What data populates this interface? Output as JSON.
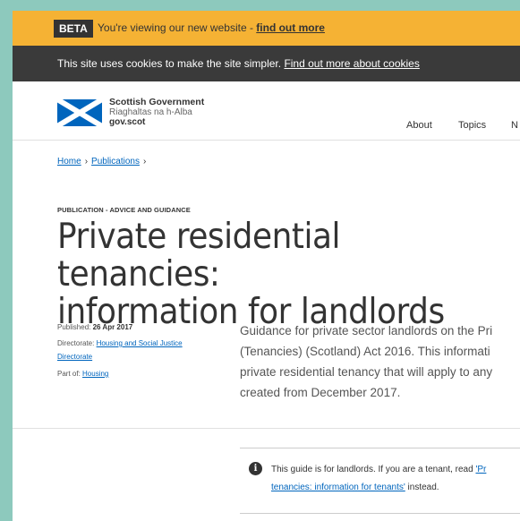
{
  "beta": {
    "badge": "BETA",
    "text": "You're viewing our new website - ",
    "link": "find out more"
  },
  "cookies": {
    "text": "This site uses cookies to make the site simpler. ",
    "link": "Find out more about cookies"
  },
  "logo": {
    "line1": "Scottish Government",
    "line2": "Riaghaltas na h-Alba",
    "line3": "gov.scot"
  },
  "nav": [
    "About",
    "Topics",
    "N"
  ],
  "breadcrumb": {
    "home": "Home",
    "publications": "Publications",
    "separator": "›"
  },
  "publication": {
    "type": "PUBLICATION - ADVICE AND GUIDANCE",
    "title_line1": "Private residential tenancies:",
    "title_line2": "information for landlords"
  },
  "meta": {
    "published_label": "Published: ",
    "published_value": "26 Apr 2017",
    "directorate_label": "Directorate: ",
    "directorate_link_line1": "Housing and Social Justice",
    "directorate_link_line2": "Directorate",
    "part_of_label": "Part of: ",
    "part_of_link": "Housing"
  },
  "summary": {
    "line1": "Guidance for private sector landlords on the Pri",
    "line2": "(Tenancies) (Scotland) Act 2016. This informati",
    "line3": "private residential tenancy that will apply to any",
    "line4": "created from December 2017."
  },
  "notice": {
    "icon": "info-icon",
    "text_before": "This guide is for landlords. If you are a tenant, read ",
    "link_line1": "'Pr",
    "link_line2": "tenancies: information for tenants'",
    "text_after": " instead."
  },
  "colors": {
    "beta_bar": "#f5b234",
    "cookie_bar": "#3a3a3a",
    "link": "#0065bd",
    "flag_blue": "#0065bd",
    "page_border": "#8dc9bd"
  }
}
